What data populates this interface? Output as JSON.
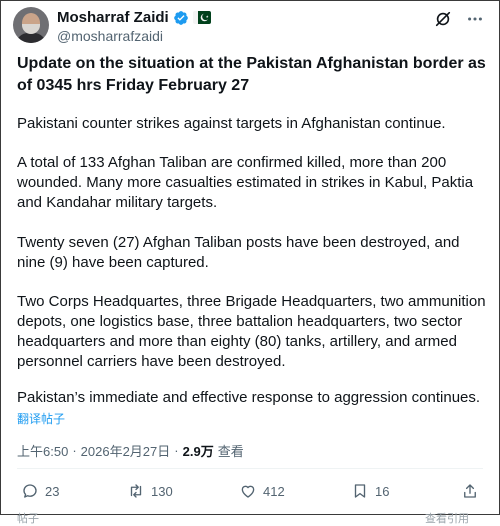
{
  "author": {
    "name": "Mosharraf Zaidi",
    "handle": "@mosharrafzaidi"
  },
  "post": {
    "title": "Update on the situation at the Pakistan Afghanistan border as of 0345 hrs Friday February 27",
    "paragraphs": [
      "Pakistani counter strikes against targets in Afghanistan continue.",
      "A total of 133 Afghan Taliban are confirmed killed, more than 200 wounded. Many more casualties estimated in strikes in Kabul, Paktia and Kandahar military targets.",
      "Twenty seven (27) Afghan Taliban posts have been destroyed, and nine (9) have been captured.",
      "Two Corps Headquartes, three Brigade Headquarters, two ammunition depots, one logistics base, three battalion headquarters, two sector headquarters and more than eighty (80) tanks, artillery, and armed personnel carriers have been destroyed.",
      "Pakistan’s immediate and effective response to aggression continues."
    ],
    "translate_label": "翻译帖子"
  },
  "meta": {
    "time": "上午6:50",
    "date": "2026年2月27日",
    "views_count": "2.9万",
    "views_label": "查看",
    "separator": "·"
  },
  "actions": {
    "replies": "23",
    "reposts": "130",
    "likes": "412",
    "bookmarks": "16"
  },
  "cut_text": {
    "left": "帖子",
    "right": "查看引用"
  },
  "colors": {
    "text": "#0f1419",
    "secondary": "#536471",
    "link": "#1d9bf0",
    "verified": "#1d9bf0"
  }
}
